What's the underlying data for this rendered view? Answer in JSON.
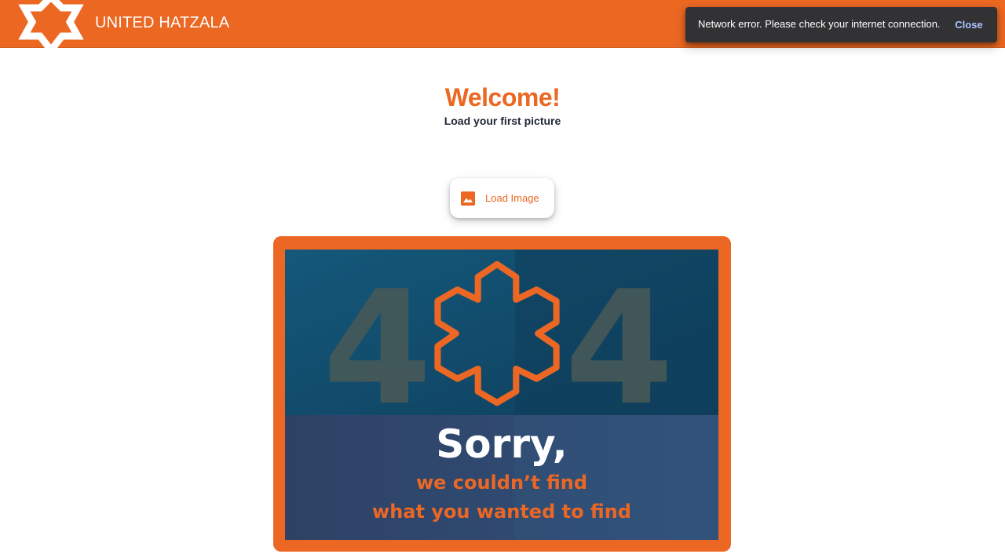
{
  "header": {
    "brand": "UNITED HATZALA",
    "logo_icon": "hatzala-star-logo",
    "background": "#eb6722"
  },
  "notification": {
    "message": "Network error. Please check your internet connection.",
    "action_label": "Close",
    "background": "#323234",
    "action_color": "#a9c4ff"
  },
  "main": {
    "title": "Welcome!",
    "subtitle": "Load your first picture",
    "load_button": {
      "label": "Load Image",
      "icon": "image-icon"
    }
  },
  "error_image": {
    "code": "404",
    "headline": "Sorry,",
    "line1": "we couldn’t find",
    "line2": "what you wanted to find",
    "accent": "#ec6724",
    "background": "#2c4a6a"
  }
}
